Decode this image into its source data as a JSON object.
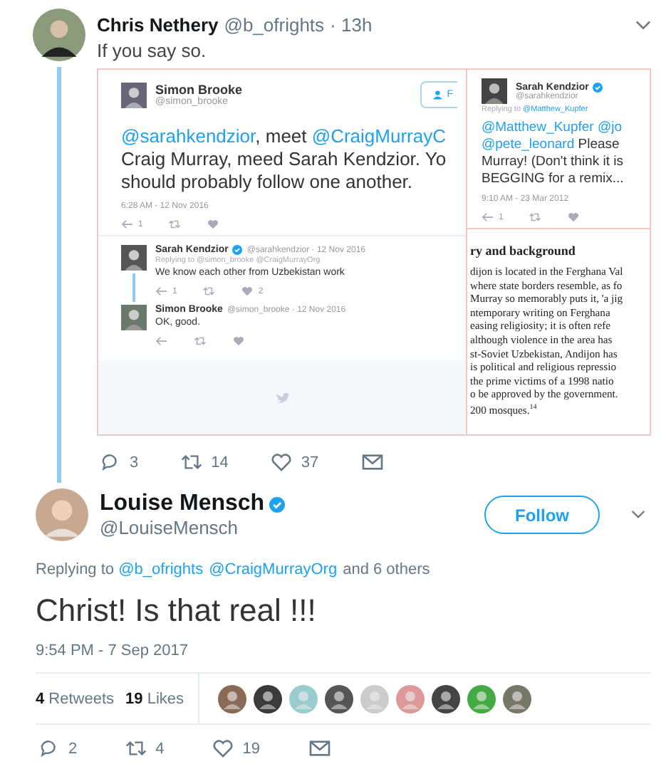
{
  "quoted_tweet": {
    "author": "Chris Nethery",
    "handle": "@b_ofrights",
    "time": "· 13h",
    "text": "If you say so.",
    "image": {
      "main_tweet": {
        "author": "Simon Brooke",
        "handle": "@simon_brooke",
        "follow": "F",
        "lines": [
          [
            {
              "text": "@sarahkendzior",
              "kind": "mention"
            },
            {
              "text": ", meet ",
              "kind": "plain"
            },
            {
              "text": "@CraigMurrayC",
              "kind": "mention"
            }
          ],
          [
            {
              "text": "Craig Murray, meed Sarah Kendzior. Yo",
              "kind": "plain"
            }
          ],
          [
            {
              "text": "should probably follow one another.",
              "kind": "plain"
            }
          ]
        ],
        "date": "6:28 AM - 12 Nov 2016",
        "reply_count": "1"
      },
      "replies": [
        {
          "author": "Sarah Kendzior",
          "verified": true,
          "handle": "@sarahkendzior · 12 Nov 2016",
          "replying_label": "Replying to",
          "replying_to": "@simon_brooke @CraigMurrayOrg",
          "text": "We know each other from Uzbekistan work",
          "reply_count": "1",
          "like_count": "2"
        },
        {
          "author": "Simon Brooke",
          "verified": false,
          "handle": "@simon_brooke · 12 Nov 2016",
          "text": "OK, good."
        }
      ],
      "side_tweet": {
        "author": "Sarah Kendzior",
        "verified": true,
        "handle": "@sarahkendzior",
        "replying_label": "Replying to",
        "replying_to": "@Matthew_Kupfer",
        "lines": [
          [
            {
              "text": "@Matthew_Kupfer @jo",
              "kind": "mention"
            }
          ],
          [
            {
              "text": "@pete_leonard",
              "kind": "mention"
            },
            {
              "text": " Please",
              "kind": "plain"
            }
          ],
          [
            {
              "text": "Murray! (Don't think it is",
              "kind": "plain"
            }
          ],
          [
            {
              "text": "BEGGING for a remix...",
              "kind": "plain"
            }
          ]
        ],
        "date": "9:10 AM - 23 Mar 2012",
        "reply_count": "1"
      },
      "document": {
        "heading": "ry and background",
        "lines": [
          "dijon is located in the Ferghana Val",
          "where state borders resemble, as fo",
          "Murray so memorably puts it, 'a jig",
          "ntemporary writing on Ferghana",
          "easing religiosity; it is often refe",
          "although violence in the area has",
          "st-Soviet Uzbekistan, Andijon has",
          "is political and religious repressio",
          "the prime victims of a 1998 natio",
          "o be approved by the government.",
          "200 mosques."
        ],
        "footnote": "14"
      }
    },
    "actions": {
      "replies": "3",
      "retweets": "14",
      "likes": "37"
    }
  },
  "tweet": {
    "author": "Louise Mensch",
    "verified": true,
    "handle": "@LouiseMensch",
    "follow": "Follow",
    "replying_label": "Replying to",
    "replying_to": [
      "@b_ofrights",
      "@CraigMurrayOrg"
    ],
    "replying_rest": "and 6 others",
    "text": "Christ! Is that real !!!",
    "date": "9:54 PM - 7 Sep 2017",
    "retweets": "**4** Retweets",
    "likes": "**19** Likes",
    "actions": {
      "replies": "2",
      "retweets": "4",
      "likes": "19"
    }
  }
}
